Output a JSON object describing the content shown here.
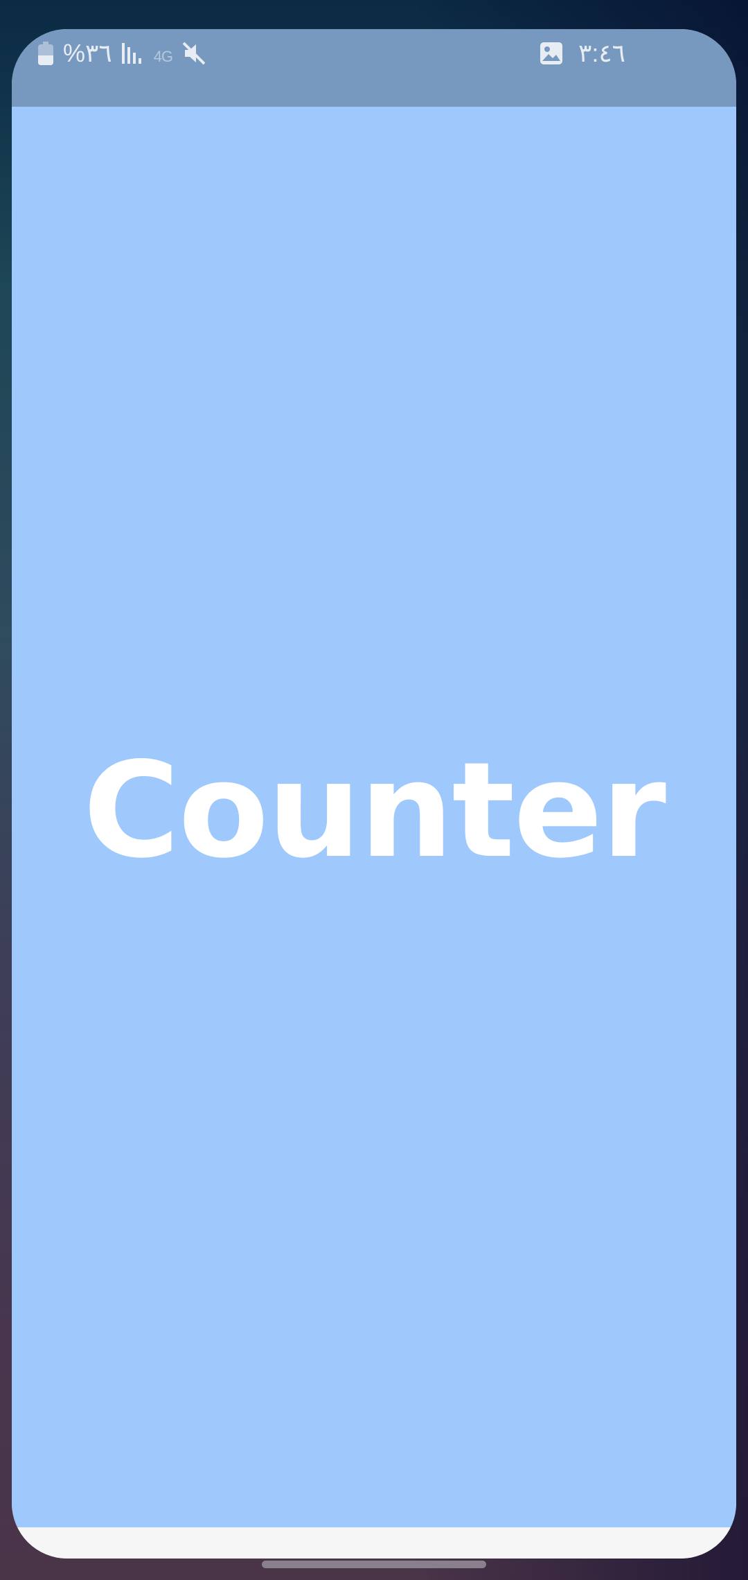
{
  "status_bar": {
    "battery_percent": "%٣٦",
    "network_label": "4G",
    "time": "٣:٤٦",
    "icons": [
      "battery-icon",
      "signal-icon",
      "network-icon",
      "mute-icon",
      "gallery-icon"
    ]
  },
  "main": {
    "title": "Counter"
  },
  "colors": {
    "status_bar_bg": "#7899bf",
    "content_bg": "#9fc8fc",
    "title_color": "#ffffff"
  }
}
